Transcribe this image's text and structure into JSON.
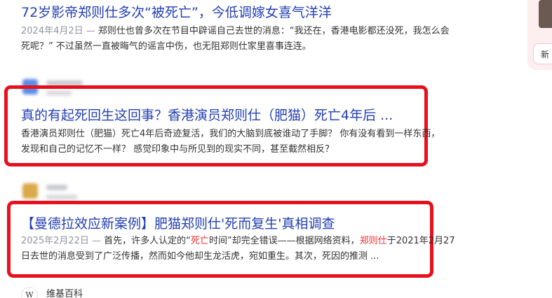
{
  "results": [
    {
      "title": "72岁影帝郑则仕多次“被死亡”，今低调嫁女喜气洋洋",
      "date": "2024年4月2日 —",
      "snippet_line1": "郑则仕也曾多次在节目中辟谣自己去世的消息：“我还在，香港电影都还没死，我怎么会",
      "snippet_line2": "死呢？” 不过虽然一直被晦气的谣言中伤，也无阻郑则仕家里喜事连连。"
    },
    {
      "title": "真的有起死回生这回事？香港演员郑则仕（肥猫）死亡4年后 ...",
      "snippet_line1": "香港演员郑则仕（肥猫）死亡4年后奇迹复活，我们的大脑到底被谁动了手脚？ 你有没有看到一样东西，",
      "snippet_line2": "发现和自己的记忆不一样？ 感觉印象中与所见到的现实不同，甚至截然相反？"
    },
    {
      "title": "【曼德拉效应新案例】肥猫郑则仕'死而复生'真相调查",
      "date": "2025年2月22日 —",
      "snippet_pre": "首先，许多人认定的“",
      "snippet_hl1": "死亡",
      "snippet_mid": "时间”却完全错误——根据网络资料，",
      "snippet_hl2": "郑则仕",
      "snippet_post": "于2021年2月27",
      "snippet_line2": "日去世的消息受到了广泛传播，然而如今他却生龙活虎，宛如重生。其次，死因的推测 ..."
    }
  ],
  "next_source": {
    "icon_char": "W",
    "name": "维基百科"
  },
  "side_panel": {
    "pill_text": "新"
  },
  "colors": {
    "title_link": "#2440b3",
    "highlight": "#f73131",
    "annotation_box": "#e6101e"
  }
}
